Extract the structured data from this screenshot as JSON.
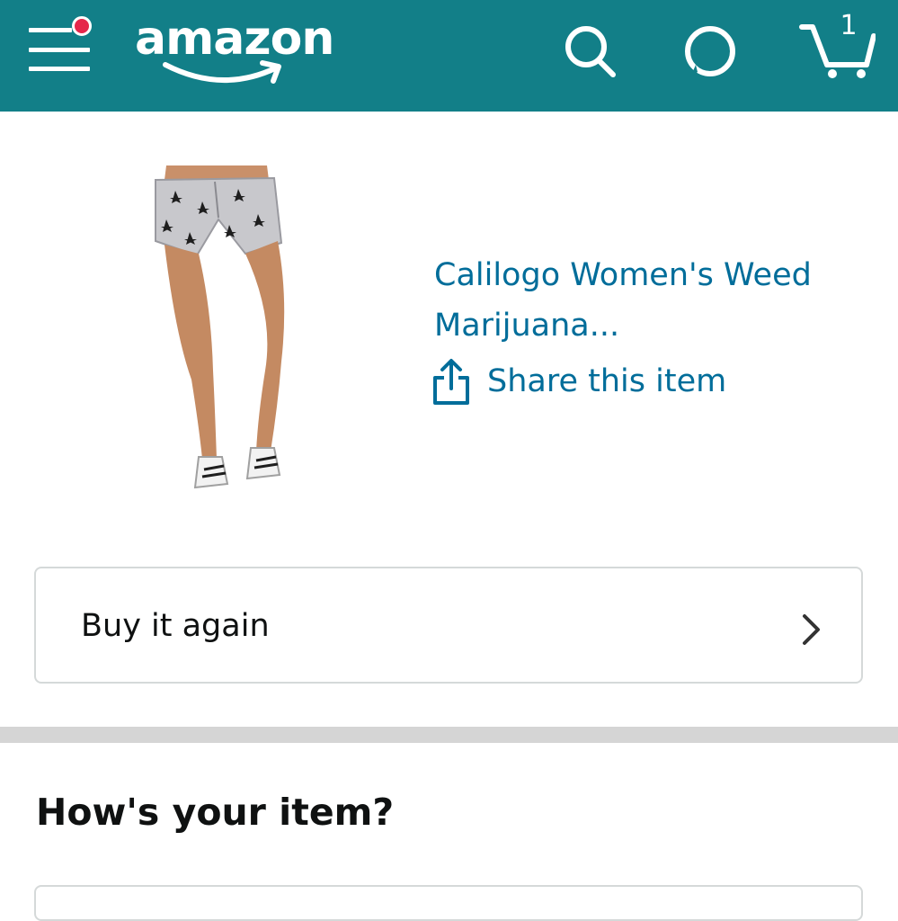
{
  "header": {
    "brand": "amazon",
    "menu_icon": "hamburger-menu-icon",
    "notification_dot_color": "#e5274b",
    "search_icon": "search-icon",
    "alexa_icon": "alexa-icon",
    "cart_icon": "cart-icon",
    "cart_count": "1",
    "background_color": "#127f88"
  },
  "product": {
    "image": "product-photo",
    "title": "Calilogo Women's Weed Marijuana...",
    "share_icon": "share-icon",
    "share_label": "Share this item",
    "link_color": "#006d9a"
  },
  "actions": {
    "buy_again_label": "Buy it again",
    "chevron_icon": "chevron-right-icon"
  },
  "review_section": {
    "heading": "How's your item?"
  }
}
